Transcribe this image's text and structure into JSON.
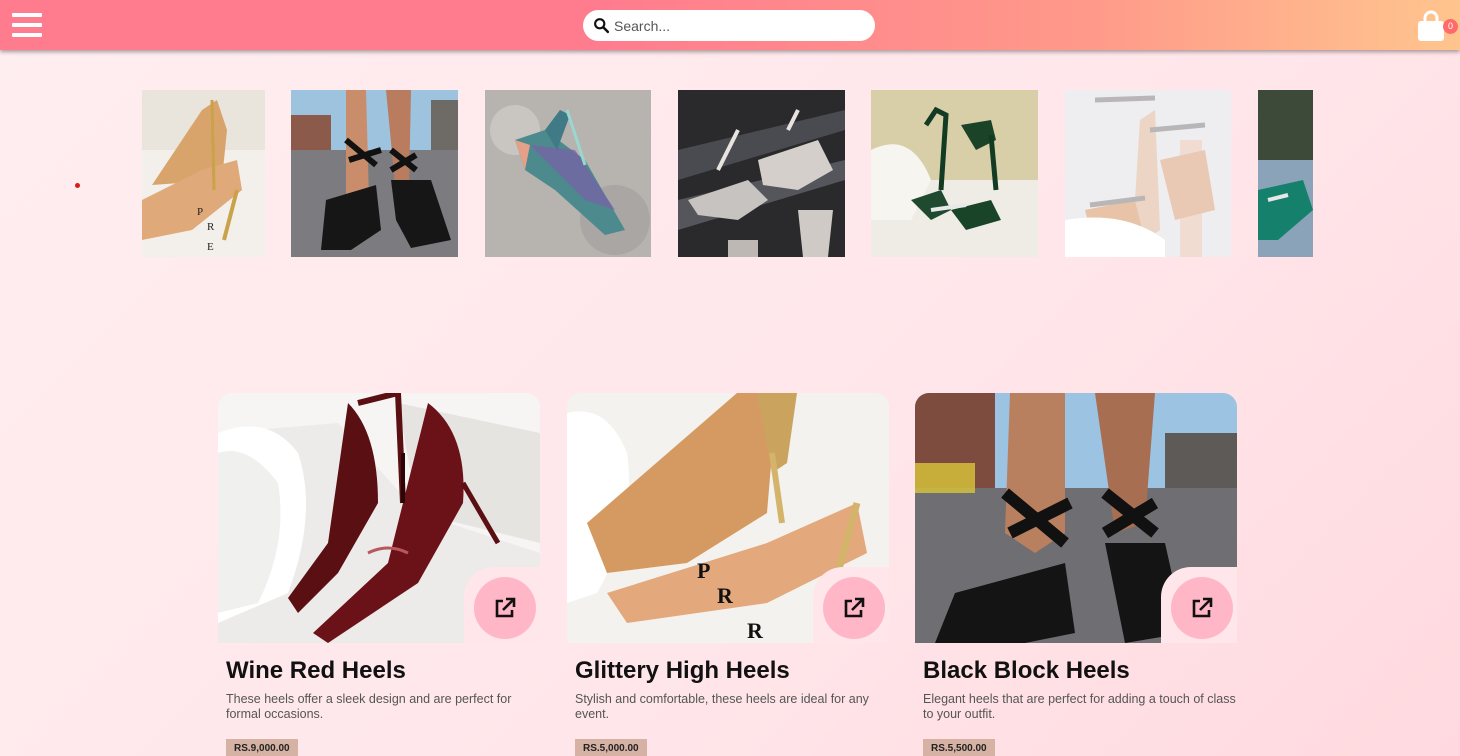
{
  "header": {
    "search_placeholder": "Search...",
    "cart_count": "0",
    "menu_icon": "hamburger-icon",
    "cart_icon": "shopping-bag-icon",
    "search_icon": "search-icon"
  },
  "carousel": {
    "slides": [
      {
        "name": "gold-glitter-heel"
      },
      {
        "name": "black-lace-up-block-heels"
      },
      {
        "name": "multicolor-glitter-pump"
      },
      {
        "name": "crystal-embellished-sandals"
      },
      {
        "name": "green-jeweled-sandals"
      },
      {
        "name": "nude-crystal-ankle-strap-heels"
      },
      {
        "name": "teal-satin-heel"
      }
    ]
  },
  "products": [
    {
      "title": "Wine Red Heels",
      "description": "These heels offer a sleek design and are perfect for formal occasions.",
      "price": "RS.9,000.00"
    },
    {
      "title": "Glittery High Heels",
      "description": "Stylish and comfortable, these heels are ideal for any event.",
      "price": "RS.5,000.00"
    },
    {
      "title": "Black Block Heels",
      "description": "Elegant heels that are perfect for adding a touch of class to your outfit.",
      "price": "RS.5,500.00"
    }
  ],
  "colors": {
    "header_start": "#ff7b8e",
    "header_end": "#ffc58e",
    "page_bg": "#ffe6ea",
    "open_button": "#ffb6c6",
    "price_tag": "#d5b2a4"
  }
}
